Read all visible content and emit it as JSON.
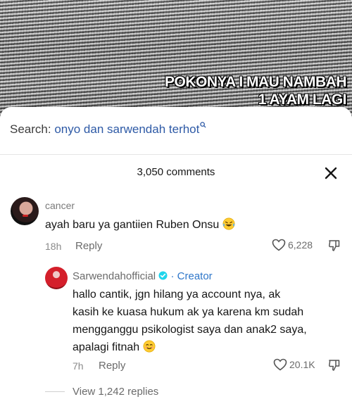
{
  "video": {
    "caption_line1": "POKONYA I MAU NAMBAH",
    "caption_line2": "1 AYAM LAGI"
  },
  "search": {
    "label": "Search:",
    "query": "onyo dan sarwendah terhot"
  },
  "comments_header": {
    "count_label": "3,050 comments"
  },
  "comments": [
    {
      "username": "cancer",
      "text": "ayah baru ya gantiien Ruben Onsu",
      "emoji": "laughing-crying-emoji",
      "time": "18h",
      "reply_label": "Reply",
      "likes": "6,228"
    }
  ],
  "reply": {
    "username": "Sarwendahofficial",
    "separator": "·",
    "badge": "Creator",
    "line1": "hallo cantik, jgn hilang ya account nya, ak",
    "line2": "kasih ke kuasa hukum ak ya karena km sudah",
    "line3": "mengganggu psikologist saya dan anak2 saya,",
    "line4": "apalagi fitnah",
    "emoji": "smiling-emoji",
    "time": "7h",
    "reply_label": "Reply",
    "likes": "20.1K"
  },
  "view_replies": {
    "label": "View 1,242 replies"
  },
  "colors": {
    "link_blue": "#2e5aa6",
    "creator_blue": "#2e76c9",
    "verified_blue": "#20d5ec"
  }
}
